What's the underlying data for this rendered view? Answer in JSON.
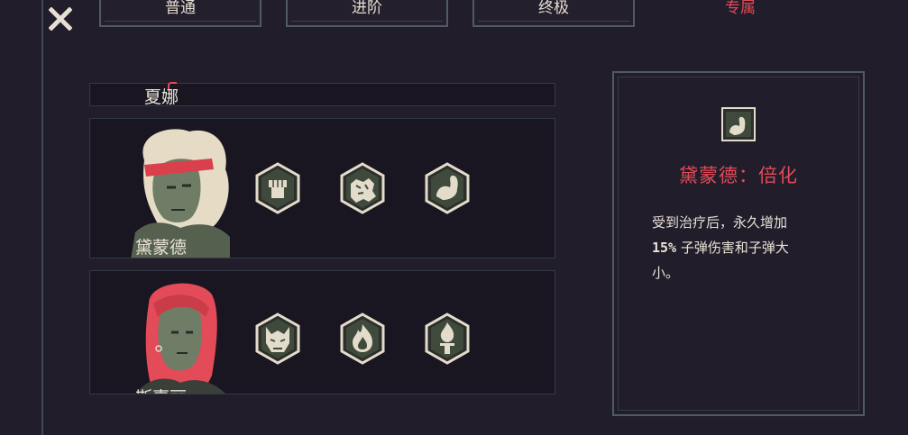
{
  "tabs": [
    {
      "label": "普通",
      "active": false
    },
    {
      "label": "进阶",
      "active": false
    },
    {
      "label": "终极",
      "active": false
    },
    {
      "label": "专属",
      "active": true
    }
  ],
  "section_header": "夏娜",
  "characters": [
    {
      "name": "黛蒙德",
      "perks": [
        "fist-icon",
        "rock-fist-icon",
        "flexed-arm-icon"
      ]
    },
    {
      "name": "斯嘉丽",
      "perks": [
        "demon-face-icon",
        "flame-icon",
        "torch-icon"
      ]
    }
  ],
  "detail": {
    "icon": "flexed-arm-icon",
    "title": "黛蒙德：倍化",
    "desc_line1": "受到治疗后，永久增加",
    "desc_percent": "15%",
    "desc_line2": " 子弹伤害和子弹大",
    "desc_line3": "小。"
  },
  "colors": {
    "background": "#221d2b",
    "accent_red": "#e24b57",
    "border": "#4f5b64",
    "icon_fill": "#e4dccb",
    "icon_dark": "#3f4a3c"
  }
}
